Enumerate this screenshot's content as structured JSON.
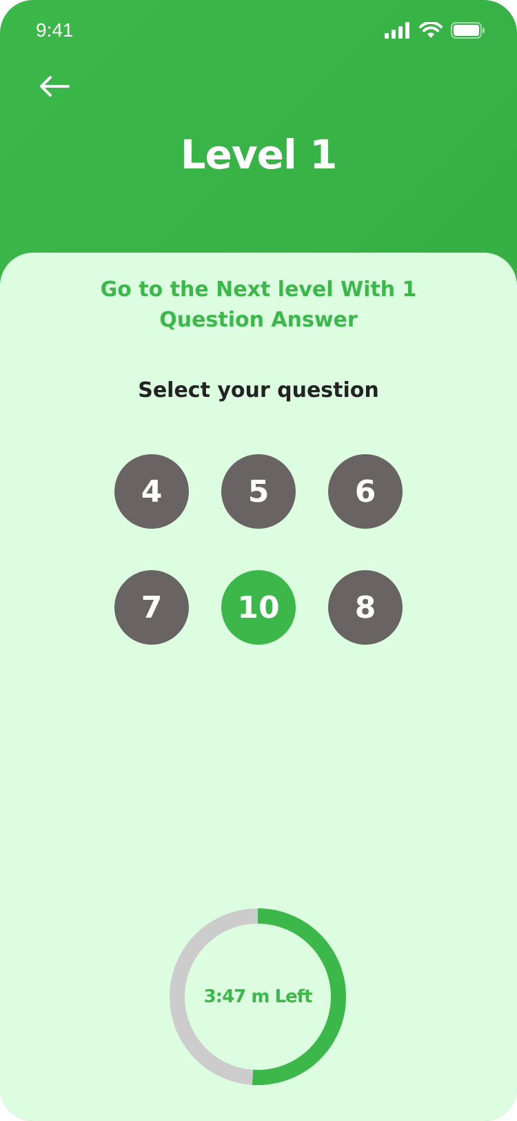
{
  "status_bar": {
    "time": "9:41",
    "icons": [
      "signal-icon",
      "wifi-icon",
      "battery-icon"
    ]
  },
  "header": {
    "back_icon": "arrow-left-icon",
    "title": "Level 1"
  },
  "content": {
    "subtitle": "Go to the Next level With 1 Question  Answer",
    "select_label": "Select your question",
    "questions": [
      {
        "label": "4",
        "selected": false
      },
      {
        "label": "5",
        "selected": false
      },
      {
        "label": "6",
        "selected": false
      },
      {
        "label": "7",
        "selected": false
      },
      {
        "label": "10",
        "selected": true
      },
      {
        "label": "8",
        "selected": false
      }
    ]
  },
  "timer": {
    "label": "3:47 m Left",
    "progress": 0.51
  },
  "colors": {
    "primary": "#3cb84a",
    "card_bg": "#dcfde0",
    "question_bg": "#696363",
    "track": "#cccccc"
  }
}
